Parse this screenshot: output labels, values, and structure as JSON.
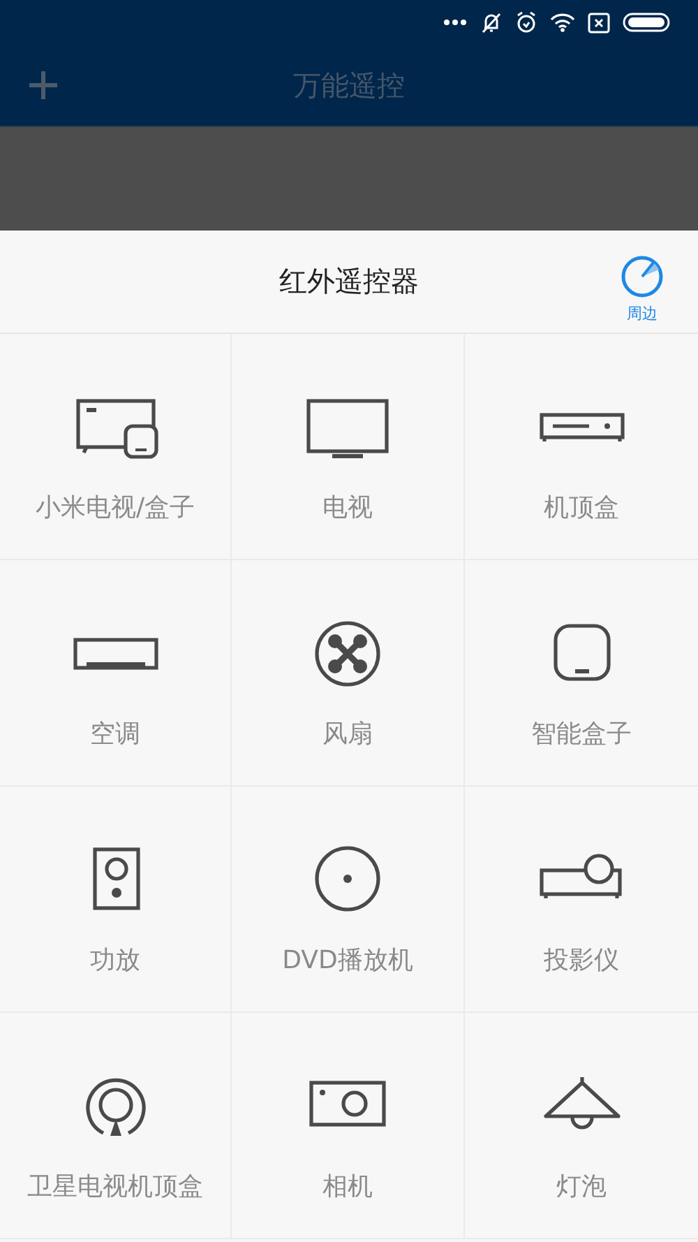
{
  "app_bar": {
    "title": "万能遥控"
  },
  "sheet": {
    "title": "红外遥控器",
    "nearby": {
      "label": "周边"
    }
  },
  "devices": [
    {
      "label": "小米电视/盒子",
      "kind": "mitv"
    },
    {
      "label": "电视",
      "kind": "tv"
    },
    {
      "label": "机顶盒",
      "kind": "stb"
    },
    {
      "label": "空调",
      "kind": "ac"
    },
    {
      "label": "风扇",
      "kind": "fan"
    },
    {
      "label": "智能盒子",
      "kind": "box"
    },
    {
      "label": "功放",
      "kind": "speaker"
    },
    {
      "label": "DVD播放机",
      "kind": "dvd"
    },
    {
      "label": "投影仪",
      "kind": "projector"
    },
    {
      "label": "卫星电视机顶盒",
      "kind": "satellite"
    },
    {
      "label": "相机",
      "kind": "camera"
    },
    {
      "label": "灯泡",
      "kind": "lamp"
    }
  ]
}
